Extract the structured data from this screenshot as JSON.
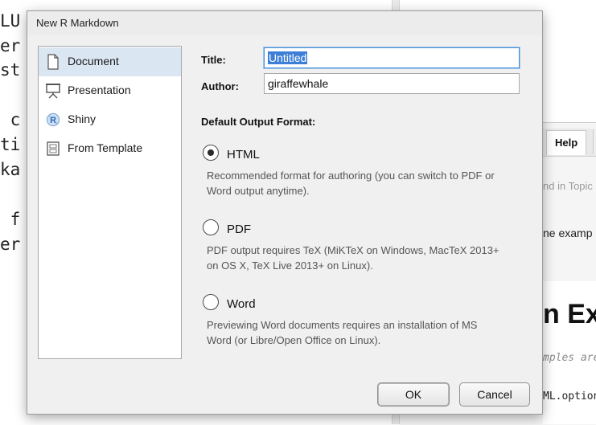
{
  "background": {
    "editor_lines": [
      "LU",
      "er",
      "st",
      "",
      " c",
      "ti",
      "ka",
      "",
      " f",
      "er"
    ],
    "help_tab": "Help",
    "help_find_placeholder": "nd in Topic",
    "help_fragment": "ne examp",
    "help_heading": "n Ext",
    "help_code_comment": "mples are",
    "help_code_line": "ML.option"
  },
  "dialog": {
    "title": "New R Markdown",
    "sidebar": [
      {
        "label": "Document",
        "icon": "document-icon",
        "selected": true
      },
      {
        "label": "Presentation",
        "icon": "presentation-icon",
        "selected": false
      },
      {
        "label": "Shiny",
        "icon": "shiny-r-icon",
        "selected": false
      },
      {
        "label": "From Template",
        "icon": "template-icon",
        "selected": false
      }
    ],
    "title_label": "Title:",
    "title_value": "Untitled",
    "author_label": "Author:",
    "author_value": "giraffewhale",
    "default_output_label": "Default Output Format:",
    "formats": [
      {
        "label": "HTML",
        "checked": true,
        "description_lines": [
          "Recommended format for authoring (you can switch to PDF or",
          "Word output anytime)."
        ]
      },
      {
        "label": "PDF",
        "checked": false,
        "description_lines": [
          "PDF output requires TeX (MiKTeX on Windows, MacTeX 2013+",
          "on OS X, TeX Live 2013+ on Linux)."
        ]
      },
      {
        "label": "Word",
        "checked": false,
        "description_lines": [
          "Previewing Word documents requires an installation of MS",
          "Word (or Libre/Open Office on Linux)."
        ]
      }
    ],
    "ok_label": "OK",
    "cancel_label": "Cancel"
  }
}
